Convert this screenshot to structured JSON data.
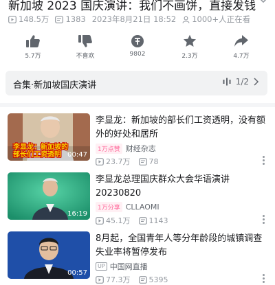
{
  "video": {
    "title": "新加坡 2023 国庆演讲：我们不画饼，直接发钱",
    "views": "148.5万",
    "danmaku": "1383",
    "date": "2023年8月21日 18:52",
    "watching": "1000+人正在看"
  },
  "actions": [
    {
      "icon": "thumb-up-icon",
      "label": "5.7万"
    },
    {
      "icon": "thumb-down-icon",
      "label": "不喜欢"
    },
    {
      "icon": "coin-icon",
      "label": "9802"
    },
    {
      "icon": "star-icon",
      "label": "2.3万"
    },
    {
      "icon": "share-icon",
      "label": "4.7万"
    }
  ],
  "collection": {
    "title": "合集·新加坡国庆演讲",
    "page": "1/2"
  },
  "recommendations": [
    {
      "title": "李显龙：新加坡的部长们工资透明，没有额外的好处和居所",
      "duration": "00:47",
      "badge": "1万点赞",
      "uploader": "财经杂志",
      "uploader_prefix": "",
      "views": "23.7万",
      "comments": "78",
      "caption_line1": "李显龙：新加坡的",
      "caption_line2": "部长们工资透明"
    },
    {
      "title": "李显龙总理国庆群众大会华语演讲20230820",
      "duration": "16:19",
      "badge": "1万分享",
      "uploader": "CLLAOMI",
      "uploader_prefix": "",
      "views": "45.1万",
      "comments": "1143"
    },
    {
      "title": "8月起，全国青年人等分年龄段的城镇调查失业率将暂停发布",
      "duration": "00:57",
      "badge": "",
      "uploader": "中国网直播",
      "uploader_prefix": "UP",
      "views": "77.3万",
      "comments": "5395"
    }
  ],
  "colors": {
    "accent": "#ff6699",
    "icon": "#61666d",
    "muted": "#9499a0"
  }
}
